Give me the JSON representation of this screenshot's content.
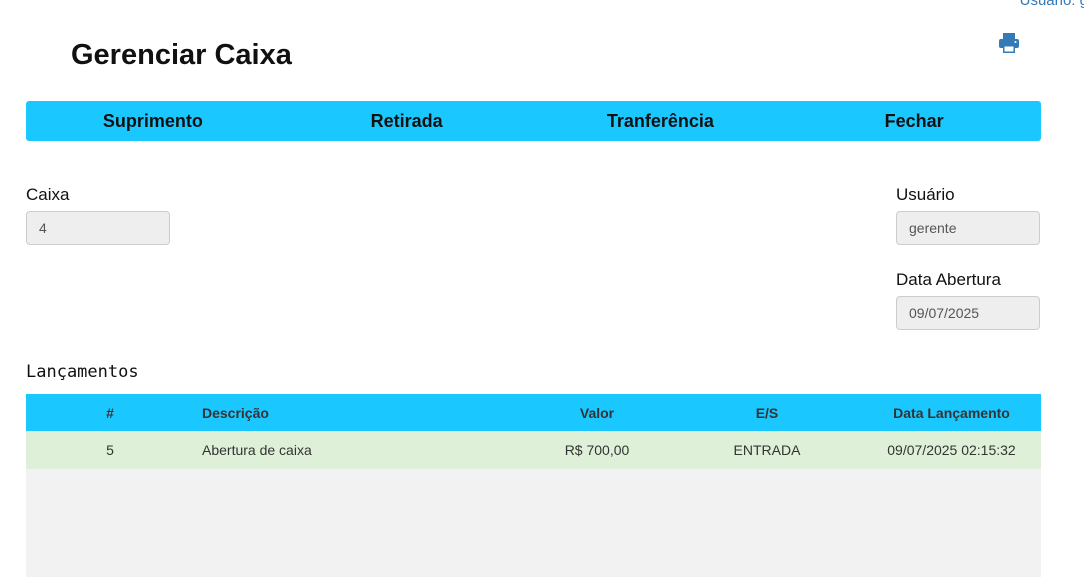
{
  "header": {
    "user_label": "Usuário: g",
    "title": "Gerenciar Caixa",
    "print_icon": "print-icon"
  },
  "actions": [
    {
      "label": "Suprimento"
    },
    {
      "label": "Retirada"
    },
    {
      "label": "Tranferência"
    },
    {
      "label": "Fechar"
    }
  ],
  "form": {
    "caixa_label": "Caixa",
    "caixa_value": "4",
    "usuario_label": "Usuário",
    "usuario_value": "gerente",
    "data_abertura_label": "Data Abertura",
    "data_abertura_value": "09/07/2025"
  },
  "lancamentos": {
    "title": "Lançamentos",
    "columns": [
      "#",
      "Descrição",
      "Valor",
      "E/S",
      "Data Lançamento"
    ],
    "rows": [
      [
        "5",
        "Abertura de caixa",
        "R$ 700,00",
        "ENTRADA",
        "09/07/2025 02:15:32"
      ]
    ]
  },
  "colors": {
    "accent": "#1ac8ff",
    "row_success": "#dff0d8",
    "link": "#337ab7"
  }
}
